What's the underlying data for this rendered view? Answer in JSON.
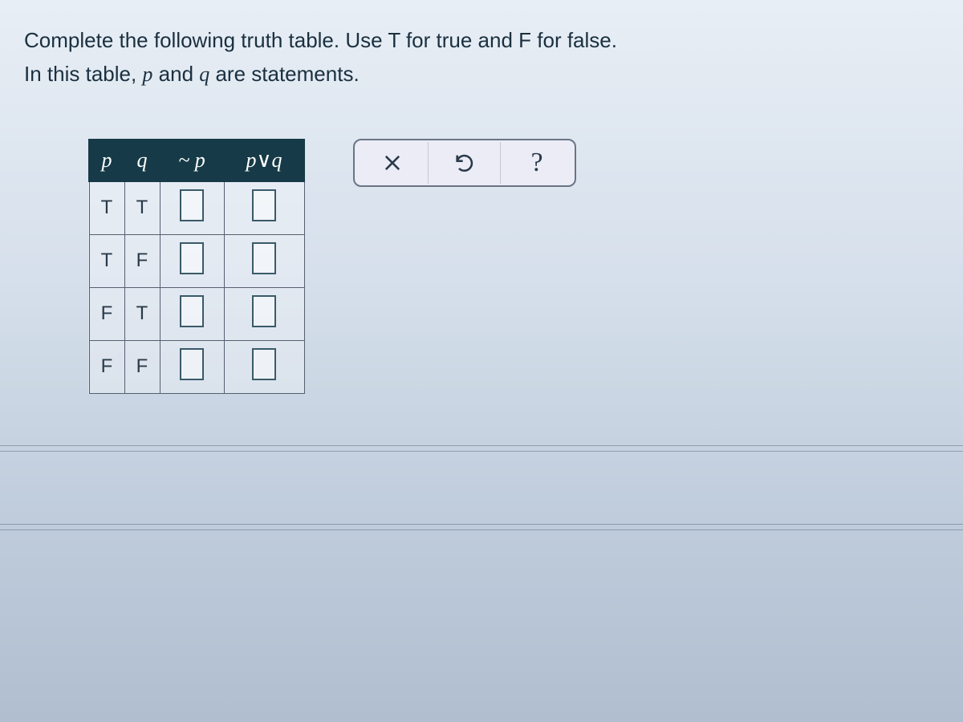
{
  "prompt": {
    "line1_a": "Complete the following truth table. Use T for true and F for false.",
    "line2_a": "In this table, ",
    "var_p": "p",
    "line2_b": " and ",
    "var_q": "q",
    "line2_c": " are statements."
  },
  "table": {
    "headers": {
      "p": "p",
      "q": "q",
      "not_p": "~ p",
      "p_or_q_left": "p",
      "p_or_q_sym": "∨",
      "p_or_q_right": "q"
    },
    "rows": [
      {
        "p": "T",
        "q": "T",
        "not_p": "",
        "p_or_q": ""
      },
      {
        "p": "T",
        "q": "F",
        "not_p": "",
        "p_or_q": ""
      },
      {
        "p": "F",
        "q": "T",
        "not_p": "",
        "p_or_q": ""
      },
      {
        "p": "F",
        "q": "F",
        "not_p": "",
        "p_or_q": ""
      }
    ]
  },
  "toolbar": {
    "clear_label": "Clear",
    "undo_label": "Undo",
    "help_label": "?"
  }
}
